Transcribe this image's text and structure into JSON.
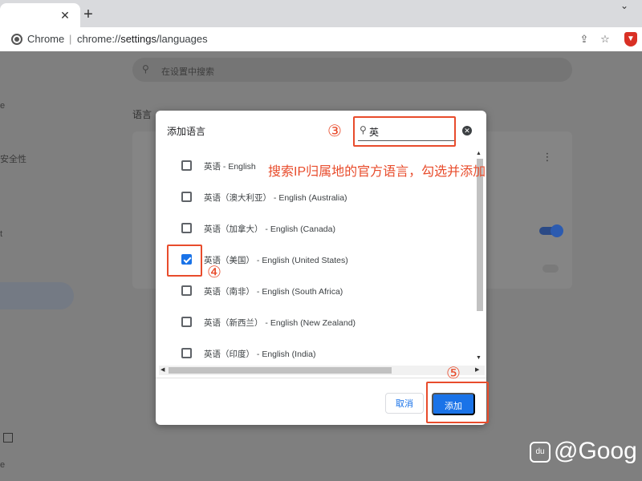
{
  "browser": {
    "omnibox": {
      "scheme_label": "Chrome",
      "separator": "|",
      "url_prefix": "chrome://",
      "url_bold": "settings",
      "url_suffix": "/languages"
    }
  },
  "settings_page": {
    "search_placeholder": "在设置中搜索",
    "section_title": "语言",
    "sidebar_fragments": [
      "e",
      "安全性",
      "t",
      "e"
    ]
  },
  "dialog": {
    "title": "添加语言",
    "search_value": "英",
    "languages": [
      {
        "label": "英语 - English",
        "checked": false
      },
      {
        "label": "英语（澳大利亚） - English (Australia)",
        "checked": false
      },
      {
        "label": "英语（加拿大） - English (Canada)",
        "checked": false
      },
      {
        "label": "英语（美国） - English (United States)",
        "checked": true
      },
      {
        "label": "英语（南非） - English (South Africa)",
        "checked": false
      },
      {
        "label": "英语（新西兰） - English (New Zealand)",
        "checked": false
      },
      {
        "label": "英语（印度） - English (India)",
        "checked": false
      }
    ],
    "cancel_label": "取消",
    "add_label": "添加"
  },
  "annotations": {
    "step3": "③",
    "step4": "④",
    "step5": "⑤",
    "instruction": "搜索IP归属地的官方语言，勾选并添加"
  },
  "watermark": {
    "logo": "du",
    "text": "@Goog"
  },
  "colors": {
    "accent": "#1a73e8",
    "annotation": "#e84c2c",
    "overlay": "#7f7f7f"
  }
}
